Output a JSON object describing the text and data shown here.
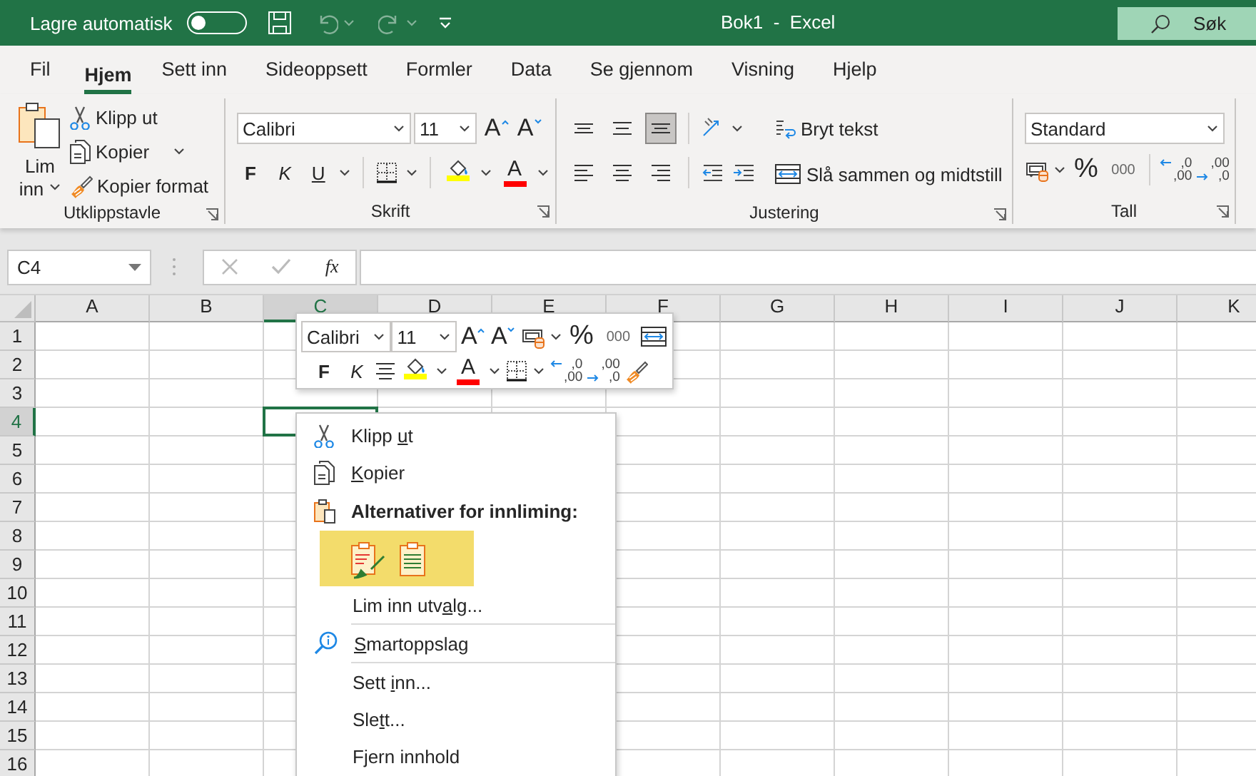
{
  "title_bar": {
    "autosave_label": "Lagre automatisk",
    "autosave_on": false,
    "undo_disabled": true,
    "redo_disabled": true,
    "title": "Bok1  -  Excel",
    "search_placeholder": "Søk"
  },
  "ribbon_tabs": [
    {
      "label": "Fil",
      "selected": false
    },
    {
      "label": "Hjem",
      "selected": true
    },
    {
      "label": "Sett inn",
      "selected": false
    },
    {
      "label": "Sideoppsett",
      "selected": false
    },
    {
      "label": "Formler",
      "selected": false
    },
    {
      "label": "Data",
      "selected": false
    },
    {
      "label": "Se gjennom",
      "selected": false
    },
    {
      "label": "Visning",
      "selected": false
    },
    {
      "label": "Hjelp",
      "selected": false
    }
  ],
  "clipboard_group": {
    "label": "Utklippstavle",
    "paste_top": "Lim",
    "paste_bottom": "inn",
    "cut": "Klipp ut",
    "copy": "Kopier",
    "format_painter": "Kopier format"
  },
  "font_group": {
    "label": "Skrift",
    "font": "Calibri",
    "size": "11",
    "grow": "A",
    "shrink": "A",
    "bold": "F",
    "italic": "K",
    "underline": "U",
    "font_color": "A"
  },
  "alignment_group": {
    "label": "Justering",
    "align_buttons": [
      {
        "kind": "top",
        "selected": false
      },
      {
        "kind": "middle",
        "selected": false
      },
      {
        "kind": "bottom",
        "selected": true
      },
      {
        "kind": "left",
        "selected": false
      },
      {
        "kind": "center",
        "selected": false
      },
      {
        "kind": "right",
        "selected": false
      }
    ],
    "wrap_text": "Bryt tekst",
    "merge": "Slå sammen og midtstill"
  },
  "number_group": {
    "label": "Tall",
    "format": "Standard",
    "percent": "%",
    "thousands": "000",
    "increase_decimal": [
      ",0",
      ",00"
    ],
    "decrease_decimal": [
      ",00",
      ",0"
    ]
  },
  "formula_bar": {
    "name_box": "C4",
    "function_label": "fx"
  },
  "sheet": {
    "columns": [
      {
        "label": "A",
        "selected": false
      },
      {
        "label": "B",
        "selected": false
      },
      {
        "label": "C",
        "selected": true
      },
      {
        "label": "D",
        "selected": false
      },
      {
        "label": "E",
        "selected": false
      },
      {
        "label": "F",
        "selected": false
      },
      {
        "label": "G",
        "selected": false
      },
      {
        "label": "H",
        "selected": false
      },
      {
        "label": "I",
        "selected": false
      },
      {
        "label": "J",
        "selected": false
      },
      {
        "label": "K",
        "selected": false
      }
    ],
    "rows": [
      {
        "label": "1",
        "selected": false
      },
      {
        "label": "2",
        "selected": false
      },
      {
        "label": "3",
        "selected": false
      },
      {
        "label": "4",
        "selected": true
      },
      {
        "label": "5",
        "selected": false
      },
      {
        "label": "6",
        "selected": false
      },
      {
        "label": "7",
        "selected": false
      },
      {
        "label": "8",
        "selected": false
      },
      {
        "label": "9",
        "selected": false
      },
      {
        "label": "10",
        "selected": false
      },
      {
        "label": "11",
        "selected": false
      },
      {
        "label": "12",
        "selected": false
      },
      {
        "label": "13",
        "selected": false
      },
      {
        "label": "14",
        "selected": false
      },
      {
        "label": "15",
        "selected": false
      },
      {
        "label": "16",
        "selected": false
      }
    ]
  },
  "mini_toolbar": {
    "font": "Calibri",
    "size": "11",
    "grow": "A",
    "shrink": "A",
    "percent": "%",
    "thousands": "000",
    "bold": "F",
    "italic": "K",
    "font_color": "A",
    "increase_decimal": [
      ",0",
      ",00"
    ],
    "decrease_decimal": [
      ",00",
      ",0"
    ]
  },
  "context_menu": {
    "items": [
      {
        "kind": "command",
        "before": "Klipp ",
        "key": "u",
        "after": "t"
      },
      {
        "kind": "command",
        "key": "K",
        "after": "opier"
      },
      {
        "kind": "header",
        "before": "Alternativer for innliming:"
      },
      {
        "kind": "paste_options",
        "hovered": true
      },
      {
        "kind": "command",
        "before": "Lim inn utv",
        "key": "a",
        "after": "lg..."
      },
      {
        "kind": "separator"
      },
      {
        "kind": "command",
        "key": "S",
        "after": "martoppslag"
      },
      {
        "kind": "separator"
      },
      {
        "kind": "command",
        "before": "Sett ",
        "key": "i",
        "after": "nn..."
      },
      {
        "kind": "command",
        "before": "Sle",
        "key": "t",
        "after": "t..."
      },
      {
        "kind": "command",
        "before": "Fjern innhold"
      }
    ]
  }
}
